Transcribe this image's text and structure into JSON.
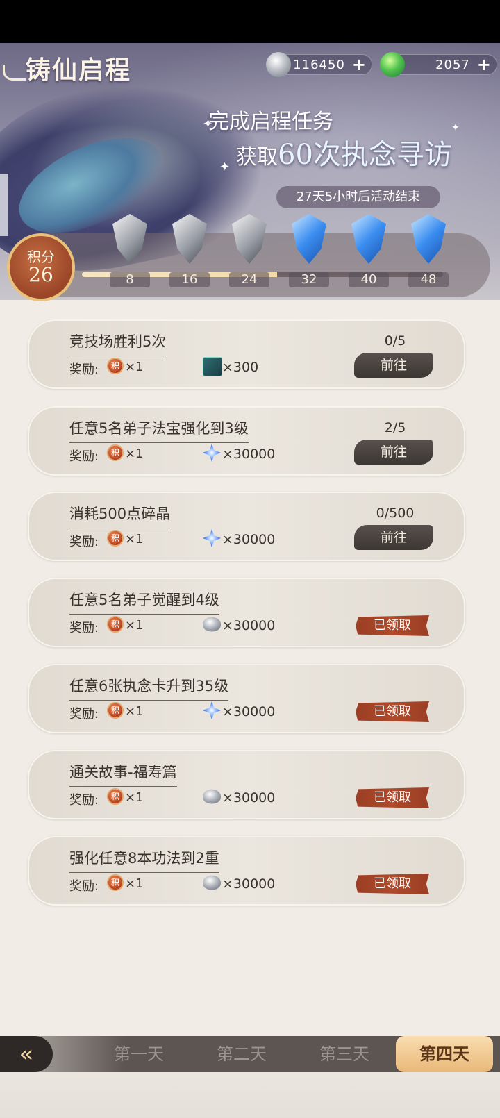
{
  "header": {
    "title": "铸仙启程",
    "currencies": [
      {
        "icon": "silver-ingot-icon",
        "value": "116450",
        "plus": "+"
      },
      {
        "icon": "jade-orb-icon",
        "value": "2057",
        "plus": "+"
      }
    ]
  },
  "promo": {
    "line1": "完成启程任务",
    "line2_prefix": "获取",
    "line2_big": "60次执念寻访",
    "countdown": "27天5小时后活动结束"
  },
  "score": {
    "label": "积分",
    "value": "26",
    "progress_fraction": 0.54
  },
  "milestones": [
    {
      "value": "8",
      "icon": "silver-feather-icon"
    },
    {
      "value": "16",
      "icon": "silver-feather-icon"
    },
    {
      "value": "24",
      "icon": "silver-feather-icon"
    },
    {
      "value": "32",
      "icon": "blue-feather-icon"
    },
    {
      "value": "40",
      "icon": "blue-feather-icon"
    },
    {
      "value": "48",
      "icon": "blue-feather-icon"
    }
  ],
  "reward_label": "奖励:",
  "point_token": "积",
  "go_label": "前往",
  "claimed_label": "已领取",
  "tasks": [
    {
      "title": "竞技场胜利5次",
      "points": "×1",
      "reward_icon": "chest-icon",
      "reward_qty": "×300",
      "progress": "0/5",
      "status": "go"
    },
    {
      "title": "任意5名弟子法宝强化到3级",
      "points": "×1",
      "reward_icon": "crystal-icon",
      "reward_qty": "×30000",
      "progress": "2/5",
      "status": "go"
    },
    {
      "title": "消耗500点碎晶",
      "points": "×1",
      "reward_icon": "crystal-icon",
      "reward_qty": "×30000",
      "progress": "0/500",
      "status": "go"
    },
    {
      "title": "任意5名弟子觉醒到4级",
      "points": "×1",
      "reward_icon": "silver-ingot-icon",
      "reward_qty": "×30000",
      "progress": "",
      "status": "claimed"
    },
    {
      "title": "任意6张执念卡升到35级",
      "points": "×1",
      "reward_icon": "crystal-icon",
      "reward_qty": "×30000",
      "progress": "",
      "status": "claimed"
    },
    {
      "title": "通关故事-福寿篇",
      "points": "×1",
      "reward_icon": "silver-ingot-icon",
      "reward_qty": "×30000",
      "progress": "",
      "status": "claimed"
    },
    {
      "title": "强化任意8本功法到2重",
      "points": "×1",
      "reward_icon": "silver-ingot-icon",
      "reward_qty": "×30000",
      "progress": "",
      "status": "claimed"
    }
  ],
  "tabs": [
    {
      "label": "第一天",
      "active": false
    },
    {
      "label": "第二天",
      "active": false
    },
    {
      "label": "第三天",
      "active": false
    },
    {
      "label": "第四天",
      "active": true
    }
  ],
  "back_icon": "back-arrow-icon"
}
